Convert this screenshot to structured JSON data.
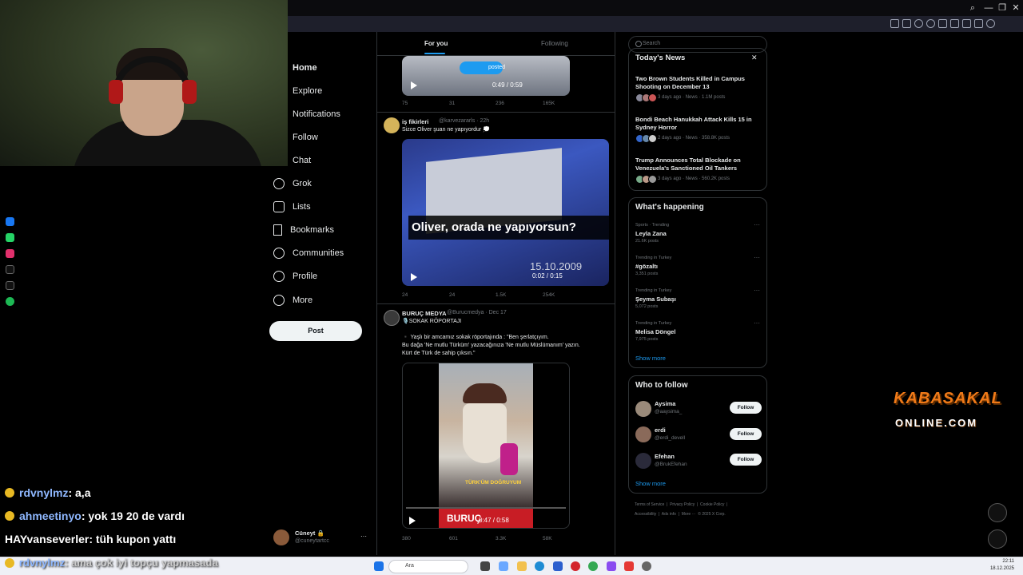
{
  "browser": {
    "window_controls": [
      "—",
      "❐",
      "✕"
    ]
  },
  "nav": {
    "items": [
      {
        "label": "Home",
        "bold": true
      },
      {
        "label": "Explore"
      },
      {
        "label": "Notifications"
      },
      {
        "label": "Follow"
      },
      {
        "label": "Chat"
      },
      {
        "label": "Grok"
      },
      {
        "label": "Lists"
      },
      {
        "label": "Bookmarks"
      },
      {
        "label": "Communities"
      },
      {
        "label": "Profile"
      },
      {
        "label": "More"
      }
    ],
    "post_label": "Post",
    "account": {
      "name": "Cüneyt 🔒",
      "handle": "@cuneytartcc",
      "more": "···"
    }
  },
  "feed": {
    "tabs": [
      "For you",
      "Following"
    ],
    "tweet1": {
      "posted_pill": "posted",
      "video_time": "0:49 / 0:59",
      "replies": "75",
      "reposts": "31",
      "likes": "236",
      "views": "165K"
    },
    "tweet2": {
      "name": "iş fikirleri",
      "handle": "@karvezararls · 22h",
      "text": "Sizce Oliver şuan ne yapıyordur 💭",
      "video_caption": "Oliver, orada ne yapıyorsun?",
      "video_date": "15.10.2009",
      "video_time": "0:02 / 0:15",
      "replies": "24",
      "reposts": "24",
      "likes": "1.5K",
      "views": "254K"
    },
    "tweet3": {
      "name": "BURUÇ MEDYA",
      "handle": "@Burucmedya · Dec 17",
      "line1": "🎙️SOKAK RÖPORTAJI",
      "line2": "▪️ Yaşlı bir amcamız sokak röportajında : \"Ben şerlatçıyım.",
      "line3": "Bu dağa 'Ne mutlu Türküm' yazacağınıza 'Ne mutlu Müslümanım' yazın.",
      "line4": "Kürt de Türk de sahip çıksın.\"",
      "video_subtitle": "TÜRK'ÜM DOĞRUYUM",
      "video_banner": "BURUÇ",
      "video_time": "0:47 / 0:58",
      "replies": "380",
      "reposts": "601",
      "likes": "3.3K",
      "views": "58K"
    }
  },
  "sidebar": {
    "search_placeholder": "Search",
    "news": {
      "title": "Today's News",
      "close": "✕",
      "items": [
        {
          "title": "Two Brown Students Killed in Campus Shooting on December 13",
          "meta": "3 days ago · News · 1.1M posts"
        },
        {
          "title": "Bondi Beach Hanukkah Attack Kills 15 in Sydney Horror",
          "meta": "2 days ago · News · 358.8K posts"
        },
        {
          "title": "Trump Announces Total Blockade on Venezuela's Sanctioned Oil Tankers",
          "meta": "3 days ago · News · 560.2K posts"
        }
      ]
    },
    "happening": {
      "title": "What's happening",
      "items": [
        {
          "cat": "Sports · Trending",
          "name": "Leyla Zana",
          "count": "21.6K posts"
        },
        {
          "cat": "Trending in Turkey",
          "name": "#gözaltı",
          "count": "3,351 posts"
        },
        {
          "cat": "Trending in Turkey",
          "name": "Şeyma Subaşı",
          "count": "5,072 posts"
        },
        {
          "cat": "Trending in Turkey",
          "name": "Melisa Döngel",
          "count": "7,975 posts"
        }
      ],
      "show_more": "Show more"
    },
    "who_to_follow": {
      "title": "Who to follow",
      "items": [
        {
          "name": "Aysima",
          "handle": "@aaysima_",
          "btn": "Follow"
        },
        {
          "name": "erdi",
          "handle": "@erdi_devell",
          "btn": "Follow"
        },
        {
          "name": "Efehan",
          "handle": "@BrukEfehan",
          "btn": "Follow"
        }
      ],
      "show_more": "Show more"
    },
    "footer": {
      "line1": "Terms of Service  |  Privacy Policy  |  Cookie Policy  |",
      "line2": "Accessibility  |  Ads info  |  More ···  © 2025 X Corp."
    }
  },
  "chat": [
    {
      "user": "rdvnylmz",
      "msg": " : a,a",
      "color": "#8fb8ff"
    },
    {
      "user": "ahmeetinyo",
      "msg": " : yok 19 20 de vardı",
      "color": "#8fb8ff"
    },
    {
      "user": "HAYvanseverler",
      "msg": " : tüh kupon yattı",
      "color": "#ffffff"
    },
    {
      "user": "rdvnylmz",
      "msg": " : ama çok iyi topçu yapmasada",
      "color": "#8fb8ff"
    }
  ],
  "logo": {
    "line1": "KABASAKAL",
    "line2": "ONLINE.COM"
  },
  "taskbar": {
    "search_placeholder": "Ara",
    "time": "22:11",
    "date": "18.12.2025"
  },
  "colors": {
    "accent": "#1d9bf0",
    "bg": "#000000",
    "logo_orange": "#f07a18"
  }
}
